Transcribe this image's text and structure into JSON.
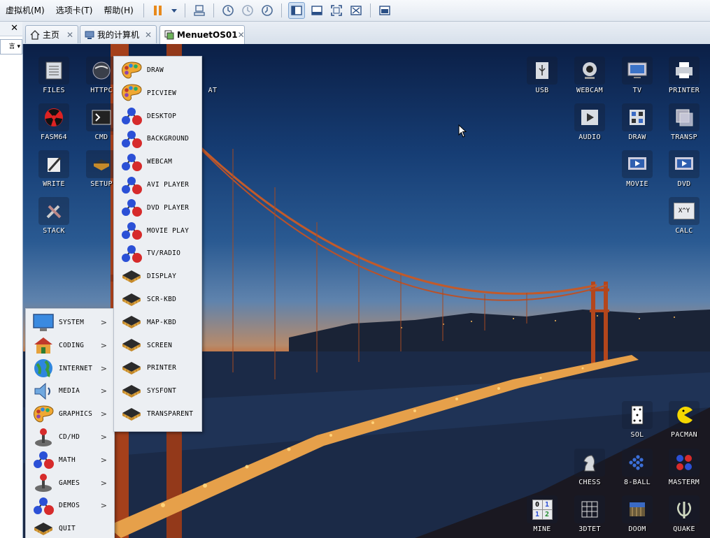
{
  "menubar": {
    "items": [
      "虚拟机(M)",
      "选项卡(T)",
      "帮助(H)"
    ],
    "pause_icon": "pause-icon",
    "toolbar_icons": [
      "send-ctrl-alt-del-icon",
      "snapshot-icon",
      "revert-snapshot-icon",
      "snapshot-manager-icon",
      "normal-view-icon",
      "quick-switch-icon",
      "fullscreen-icon",
      "unity-icon",
      "thumbnail-icon"
    ]
  },
  "left_pane": {
    "close": "✕",
    "dropdown_text": "言"
  },
  "tabs": [
    {
      "label": "主页",
      "icon": "home-icon",
      "close": "✕"
    },
    {
      "label": "我的计算机",
      "icon": "computer-icon",
      "close": "✕"
    },
    {
      "label": "MenuetOS01",
      "icon": "vm-icon",
      "close": "✕"
    }
  ],
  "desktop_left": [
    {
      "label": "FILES",
      "icon": "files-icon"
    },
    {
      "label": "HTTPC",
      "icon": "globe-icon"
    },
    {
      "label": "FASM64",
      "icon": "radiation-icon"
    },
    {
      "label": "CMD",
      "icon": "terminal-icon"
    },
    {
      "label": "WRITE",
      "icon": "pen-icon"
    },
    {
      "label": "SETUP",
      "icon": "chip-icon"
    },
    {
      "label": "STACK",
      "icon": "tools-icon"
    },
    {
      "label": "AT",
      "icon": "app-icon"
    }
  ],
  "desktop_right": [
    {
      "label": "USB",
      "icon": "usb-icon"
    },
    {
      "label": "WEBCAM",
      "icon": "webcam-icon"
    },
    {
      "label": "TV",
      "icon": "tv-icon"
    },
    {
      "label": "PRINTER",
      "icon": "printer-icon"
    },
    {
      "label": "AUDIO",
      "icon": "audio-play-icon"
    },
    {
      "label": "DRAW",
      "icon": "draw-grid-icon"
    },
    {
      "label": "TRANSP",
      "icon": "transparency-icon"
    },
    {
      "label": "MOVIE",
      "icon": "movie-icon"
    },
    {
      "label": "DVD",
      "icon": "dvd-icon"
    },
    {
      "label": "CALC",
      "icon": "calculator-icon",
      "face": "X^Y"
    },
    {
      "label": "SOL",
      "icon": "card-icon"
    },
    {
      "label": "PACMAN",
      "icon": "pacman-icon"
    },
    {
      "label": "CHESS",
      "icon": "chess-knight-icon"
    },
    {
      "label": "8-BALL",
      "icon": "triangle-balls-icon"
    },
    {
      "label": "MASTERM",
      "icon": "mastermind-icon"
    },
    {
      "label": "MINE",
      "icon": "minesweeper-icon",
      "face": [
        "0",
        "1",
        "1",
        "2"
      ]
    },
    {
      "label": "3DTET",
      "icon": "tetris-grid-icon"
    },
    {
      "label": "DOOM",
      "icon": "doom-icon"
    },
    {
      "label": "QUAKE",
      "icon": "quake-icon"
    }
  ],
  "main_menu": [
    {
      "label": "SYSTEM",
      "icon": "monitor-icon",
      "arrow": ">"
    },
    {
      "label": "CODING",
      "icon": "house-icon",
      "arrow": ">"
    },
    {
      "label": "INTERNET",
      "icon": "globe-icon",
      "arrow": ">"
    },
    {
      "label": "MEDIA",
      "icon": "speaker-icon",
      "arrow": ">"
    },
    {
      "label": "GRAPHICS",
      "icon": "palette-icon",
      "arrow": ">"
    },
    {
      "label": "CD/HD",
      "icon": "joystick-icon",
      "arrow": ">"
    },
    {
      "label": "MATH",
      "icon": "molecule-icon",
      "arrow": ">"
    },
    {
      "label": "GAMES",
      "icon": "joystick-icon",
      "arrow": ">"
    },
    {
      "label": "DEMOS",
      "icon": "molecule-icon",
      "arrow": ">"
    },
    {
      "label": "QUIT",
      "icon": "chip-icon",
      "arrow": ""
    }
  ],
  "submenu": [
    {
      "label": "DRAW",
      "icon": "palette-icon"
    },
    {
      "label": "PICVIEW",
      "icon": "palette-icon"
    },
    {
      "label": "DESKTOP",
      "icon": "molecule-icon"
    },
    {
      "label": "BACKGROUND",
      "icon": "molecule-icon"
    },
    {
      "label": "WEBCAM",
      "icon": "molecule-icon"
    },
    {
      "label": "AVI PLAYER",
      "icon": "molecule-icon"
    },
    {
      "label": "DVD PLAYER",
      "icon": "molecule-icon"
    },
    {
      "label": "MOVIE PLAY",
      "icon": "molecule-icon"
    },
    {
      "label": "TV/RADIO",
      "icon": "molecule-icon"
    },
    {
      "label": "DISPLAY",
      "icon": "chip-icon"
    },
    {
      "label": "SCR-KBD",
      "icon": "chip-icon"
    },
    {
      "label": "MAP-KBD",
      "icon": "chip-icon"
    },
    {
      "label": "SCREEN",
      "icon": "chip-icon"
    },
    {
      "label": "PRINTER",
      "icon": "chip-icon"
    },
    {
      "label": "SYSFONT",
      "icon": "chip-icon"
    },
    {
      "label": "TRANSPARENT",
      "icon": "chip-icon"
    }
  ]
}
